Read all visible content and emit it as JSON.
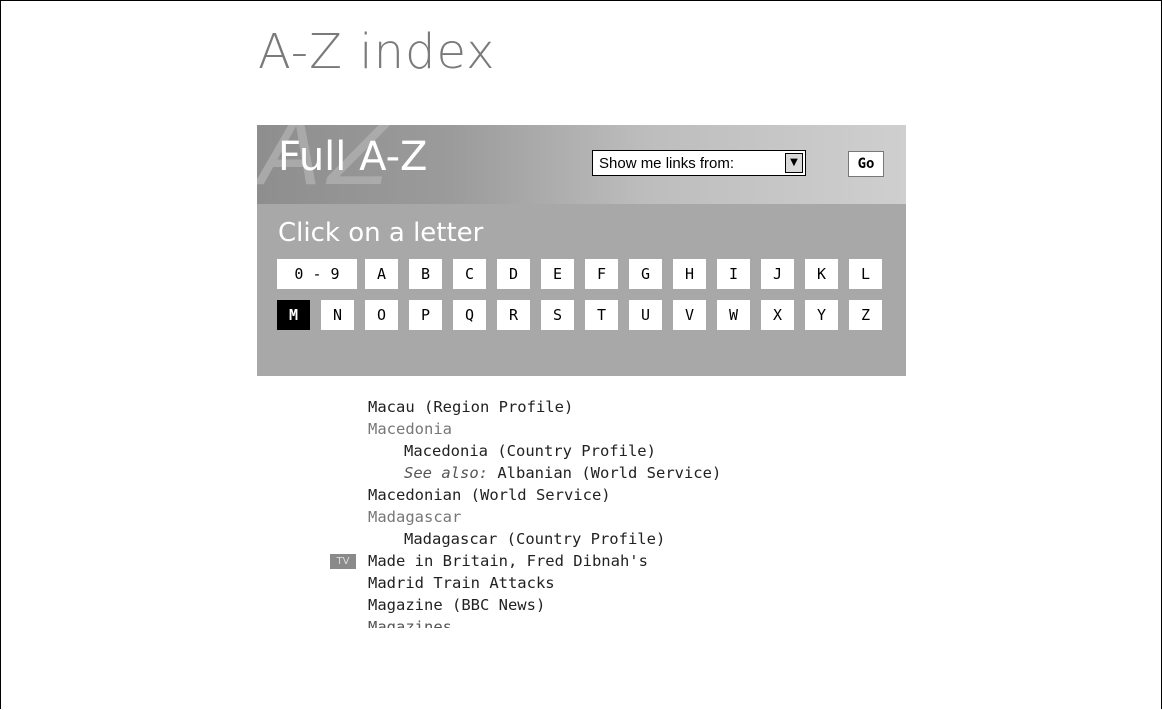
{
  "page": {
    "title": "A-Z index"
  },
  "panel": {
    "watermark": "AZ",
    "title": "Full A-Z",
    "select": {
      "value": "Show me links from:"
    },
    "go_label": "Go",
    "click_label": "Click on a letter",
    "active_letter": "M",
    "row1": [
      "0 - 9",
      "A",
      "B",
      "C",
      "D",
      "E",
      "F",
      "G",
      "H",
      "I",
      "J",
      "K",
      "L"
    ],
    "row2": [
      "M",
      "N",
      "O",
      "P",
      "Q",
      "R",
      "S",
      "T",
      "U",
      "V",
      "W",
      "X",
      "Y",
      "Z"
    ]
  },
  "results": {
    "items": [
      {
        "text": "Macau (Region Profile)",
        "kind": "link"
      },
      {
        "text": "Macedonia",
        "kind": "heading"
      },
      {
        "text": "Macedonia (Country Profile)",
        "kind": "sub-link"
      },
      {
        "prefix": "See also:",
        "text": "Albanian (World Service)",
        "kind": "see-also"
      },
      {
        "text": "Macedonian (World Service)",
        "kind": "link"
      },
      {
        "text": "Madagascar",
        "kind": "heading"
      },
      {
        "text": "Madagascar (Country Profile)",
        "kind": "sub-link"
      },
      {
        "text": "Made in Britain, Fred Dibnah's",
        "kind": "link",
        "icon": "TV"
      },
      {
        "text": "Madrid Train Attacks",
        "kind": "link"
      },
      {
        "text": "Magazine (BBC News)",
        "kind": "link"
      },
      {
        "text": "Magazines",
        "kind": "heading"
      }
    ]
  }
}
